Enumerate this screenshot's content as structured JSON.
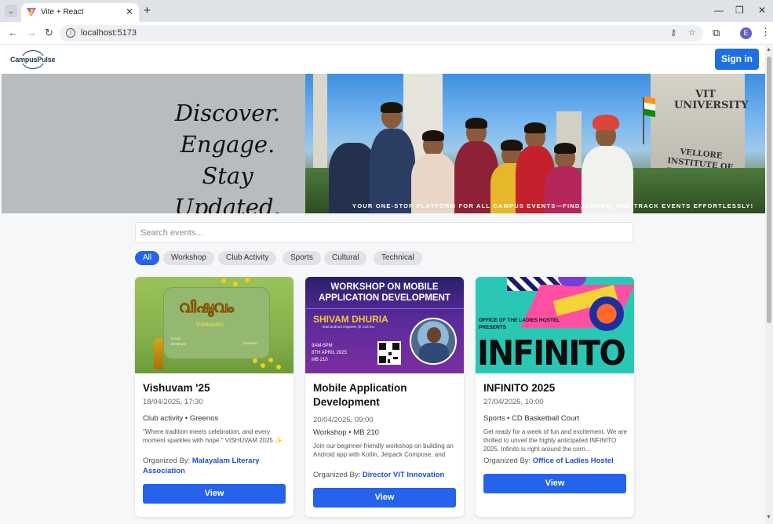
{
  "browser": {
    "tab_title": "Vite + React",
    "url": "localhost:5173",
    "profile_initial": "E"
  },
  "header": {
    "logo_text": "CampusPulse",
    "signin_label": "Sign in"
  },
  "hero": {
    "lines": [
      "Discover.",
      "Engage.",
      "Stay Updated."
    ],
    "tagline": "YOUR ONE-STOP PLATFORM FOR ALL CAMPUS EVENTS—FIND, SHARE, AND TRACK EVENTS EFFORTLESSLY!",
    "sign_top": "VIT UNIVERSITY",
    "sign_bottom": "VELLORE INSTITUTE OF TECHNOLOGY"
  },
  "search": {
    "placeholder": "Search events..."
  },
  "filters": [
    {
      "label": "All",
      "active": true
    },
    {
      "label": "Workshop",
      "active": false
    },
    {
      "label": "Club Activity",
      "active": false
    },
    {
      "label": "Sports",
      "active": false
    },
    {
      "label": "Cultural",
      "active": false
    },
    {
      "label": "Technical",
      "active": false
    }
  ],
  "events": [
    {
      "title": "Vishuvam '25",
      "datetime": "18/04/2025, 17:30",
      "meta": "Club activity • Greenos",
      "description": "\"Where tradition meets celebration, and every moment sparkles with hope.\" VISHUVAM 2025 ✨ is the vibrant celebration of Vishu by the...",
      "organized_prefix": "Organized By:",
      "organizer": "Malayalam Literary Association",
      "button": "View",
      "poster": {
        "title": "വിഷുവം",
        "subtitle": "Vishuvam",
        "date": "8 April",
        "time": "06-08 pm",
        "venue": "Greenos"
      }
    },
    {
      "title": "Mobile Application Development",
      "datetime": "20/04/2025, 09:00",
      "meta": "Workshop • MB 210",
      "description": "Join our beginner-friendly workshop on building an Android app with Kotlin, Jetpack Compose, and Room DB! Learn UI design, stat...",
      "organized_prefix": "Organized By:",
      "organizer": "Director VIT Innovation",
      "button": "View",
      "poster": {
        "heading": "WORKSHOP ON MOBILE APPLICATION DEVELOPMENT",
        "speaker": "SHIVAM DHURIA",
        "role": "lead android engineer @ Cult Inc.",
        "time": "9AM-5PM",
        "date": "8TH APRIL 2025",
        "venue": "MB 210"
      }
    },
    {
      "title": "INFINITO 2025",
      "datetime": "27/04/2025, 10:00",
      "meta": "Sports • CD Basketball Court",
      "description": "Get ready for a week of fun and excitement. We are thrilled to unveil the highly anticipated INFINITO 2025. Infinito is right around the corn...",
      "organized_prefix": "Organized By:",
      "organizer": "Office of Ladies Hostel",
      "button": "View",
      "poster": {
        "presenter": "OFFICE OF THE LADIES HOSTEL PRESENTS",
        "title": "INFINITO"
      }
    }
  ]
}
